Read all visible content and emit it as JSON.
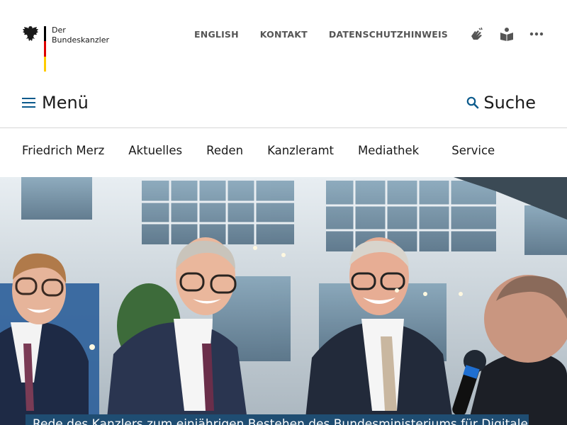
{
  "logo": {
    "line1": "Der",
    "line2": "Bundeskanzler",
    "flag_colors": [
      "#000000",
      "#dd0000",
      "#ffcc00"
    ]
  },
  "util_nav": {
    "links": [
      "ENGLISH",
      "KONTAKT",
      "DATENSCHUTZHINWEIS"
    ],
    "icons": [
      "sign-language-icon",
      "easy-language-icon",
      "more-icon"
    ]
  },
  "menubar": {
    "menu_label": "Menü",
    "search_label": "Suche",
    "accent": "#0b5a8c"
  },
  "mainnav": {
    "items": [
      "Friedrich Merz",
      "Aktuelles",
      "Reden",
      "Kanzleramt",
      "Mediathek",
      "Service"
    ]
  },
  "hero": {
    "caption": "Rede des Kanzlers zum einjährigen Bestehen des Bundesministeriums für Digitales"
  }
}
